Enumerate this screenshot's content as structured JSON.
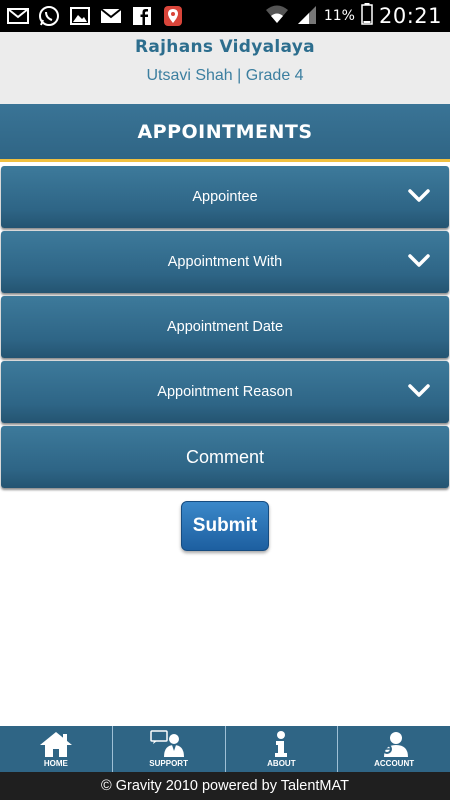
{
  "status_bar": {
    "icons_left": [
      "mail-icon",
      "whatsapp-icon",
      "gallery-icon",
      "gmail-icon",
      "facebook-icon",
      "location-pin-icon"
    ],
    "icons_right": [
      "wifi-icon",
      "signal-icon",
      "battery-icon"
    ],
    "battery": "11%",
    "time": "20:21"
  },
  "header": {
    "school_name": "Rajhans Vidyalaya",
    "student_line": "Utsavi Shah | Grade 4"
  },
  "page_title": "APPOINTMENTS",
  "form": {
    "appointee": "Appointee",
    "appointment_with": "Appointment With",
    "appointment_date": "Appointment Date",
    "appointment_reason": "Appointment Reason",
    "comment": "Comment",
    "submit": "Submit"
  },
  "nav": {
    "home": "HOME",
    "support": "SUPPORT",
    "about": "ABOUT",
    "account": "ACCOUNT"
  },
  "footer": "© Gravity 2010 powered by TalentMAT",
  "colors": {
    "primary": "#2f6585",
    "accent_underline": "#f0c040",
    "submit": "#2a70b5",
    "header_bg": "#ececec",
    "title_text": "#2d6e8e"
  }
}
